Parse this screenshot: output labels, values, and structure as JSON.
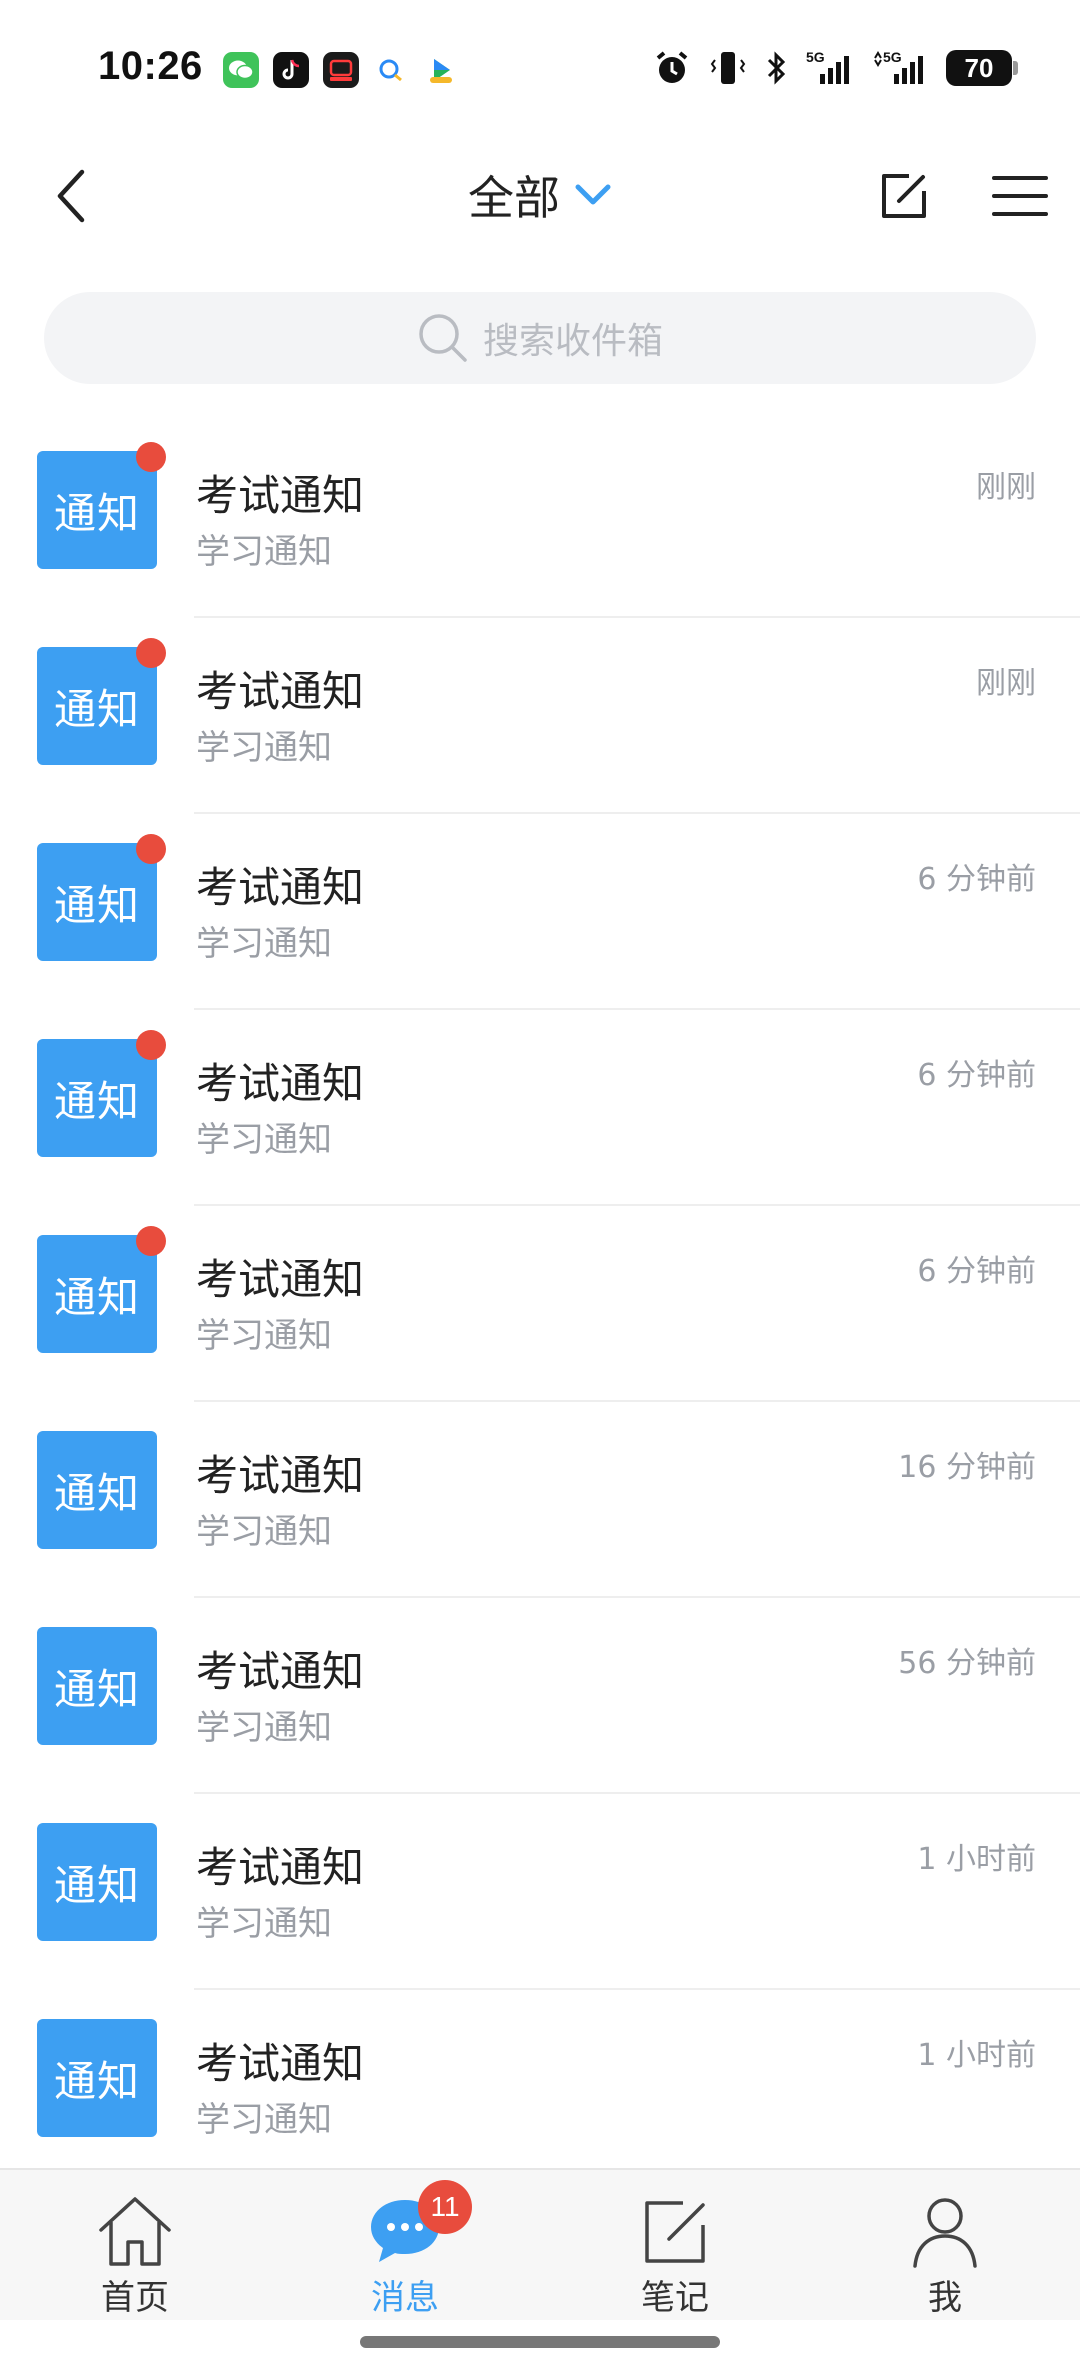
{
  "status_bar": {
    "time": "10:26",
    "battery": "70",
    "apps": [
      {
        "icon": "wechat-icon",
        "color": "#3fc35a"
      },
      {
        "icon": "tiktok-icon",
        "color": "#111111"
      },
      {
        "icon": "video-app-icon",
        "color": "#1b1b1b"
      },
      {
        "icon": "search-app-icon",
        "color": "#ffffff"
      },
      {
        "icon": "video-play-app-icon",
        "color": "#ffffff"
      }
    ],
    "indicators": [
      "alarm-icon",
      "vibrate-icon",
      "bluetooth-icon",
      "signal-5g-icon",
      "signal-5g-2-icon"
    ]
  },
  "nav": {
    "title": "全部",
    "back_icon": "chevron-left-icon",
    "dropdown_icon": "chevron-down-icon",
    "edit_icon": "compose-icon",
    "menu_icon": "hamburger-menu-icon"
  },
  "search": {
    "placeholder": "搜索收件箱",
    "icon": "search-icon"
  },
  "messages": [
    {
      "icon_text": "通知",
      "title": "考试通知",
      "subtitle": "学习通知",
      "time": "刚刚",
      "unread": true
    },
    {
      "icon_text": "通知",
      "title": "考试通知",
      "subtitle": "学习通知",
      "time": "刚刚",
      "unread": true
    },
    {
      "icon_text": "通知",
      "title": "考试通知",
      "subtitle": "学习通知",
      "time": "6 分钟前",
      "unread": true
    },
    {
      "icon_text": "通知",
      "title": "考试通知",
      "subtitle": "学习通知",
      "time": "6 分钟前",
      "unread": true
    },
    {
      "icon_text": "通知",
      "title": "考试通知",
      "subtitle": "学习通知",
      "time": "6 分钟前",
      "unread": true
    },
    {
      "icon_text": "通知",
      "title": "考试通知",
      "subtitle": "学习通知",
      "time": "16 分钟前",
      "unread": false
    },
    {
      "icon_text": "通知",
      "title": "考试通知",
      "subtitle": "学习通知",
      "time": "56 分钟前",
      "unread": false
    },
    {
      "icon_text": "通知",
      "title": "考试通知",
      "subtitle": "学习通知",
      "time": "1 小时前",
      "unread": false
    },
    {
      "icon_text": "通知",
      "title": "考试通知",
      "subtitle": "学习通知",
      "time": "1 小时前",
      "unread": false
    }
  ],
  "tabs": [
    {
      "label": "首页",
      "icon": "home-icon",
      "active": false
    },
    {
      "label": "消息",
      "icon": "chat-bubble-icon",
      "active": true,
      "badge": "11"
    },
    {
      "label": "笔记",
      "icon": "note-edit-icon",
      "active": false
    },
    {
      "label": "我",
      "icon": "person-icon",
      "active": false
    }
  ],
  "colors": {
    "accent": "#3d9ff2",
    "unread_dot": "#e84c3d",
    "badge": "#e84c3d",
    "secondary_text": "#9a9ea5"
  }
}
